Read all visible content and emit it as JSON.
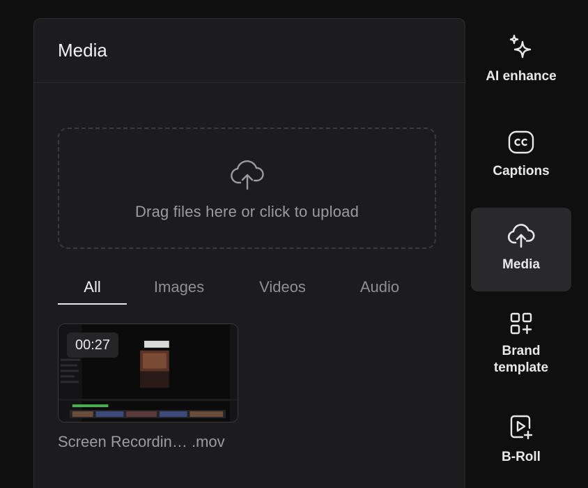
{
  "panel": {
    "title": "Media",
    "dropzone_text": "Drag files here or click to upload",
    "tabs": [
      {
        "label": "All",
        "active": true
      },
      {
        "label": "Images",
        "active": false
      },
      {
        "label": "Videos",
        "active": false
      },
      {
        "label": "Audio",
        "active": false
      }
    ],
    "media_items": [
      {
        "duration": "00:27",
        "name": "Screen Recordin… .mov"
      }
    ]
  },
  "sidebar": {
    "items": [
      {
        "label": "AI enhance",
        "icon": "sparkles-icon",
        "active": false
      },
      {
        "label": "Captions",
        "icon": "cc-icon",
        "active": false
      },
      {
        "label": "Media",
        "icon": "cloud-upload-icon",
        "active": true
      },
      {
        "label": "Brand\ntemplate",
        "icon": "grid-plus-icon",
        "active": false
      },
      {
        "label": "B-Roll",
        "icon": "play-plus-icon",
        "active": false
      }
    ]
  },
  "colors": {
    "background": "#0f0f10",
    "panel": "#1c1c1e",
    "active_item": "#29292c",
    "muted_text": "#9b9ba0"
  }
}
